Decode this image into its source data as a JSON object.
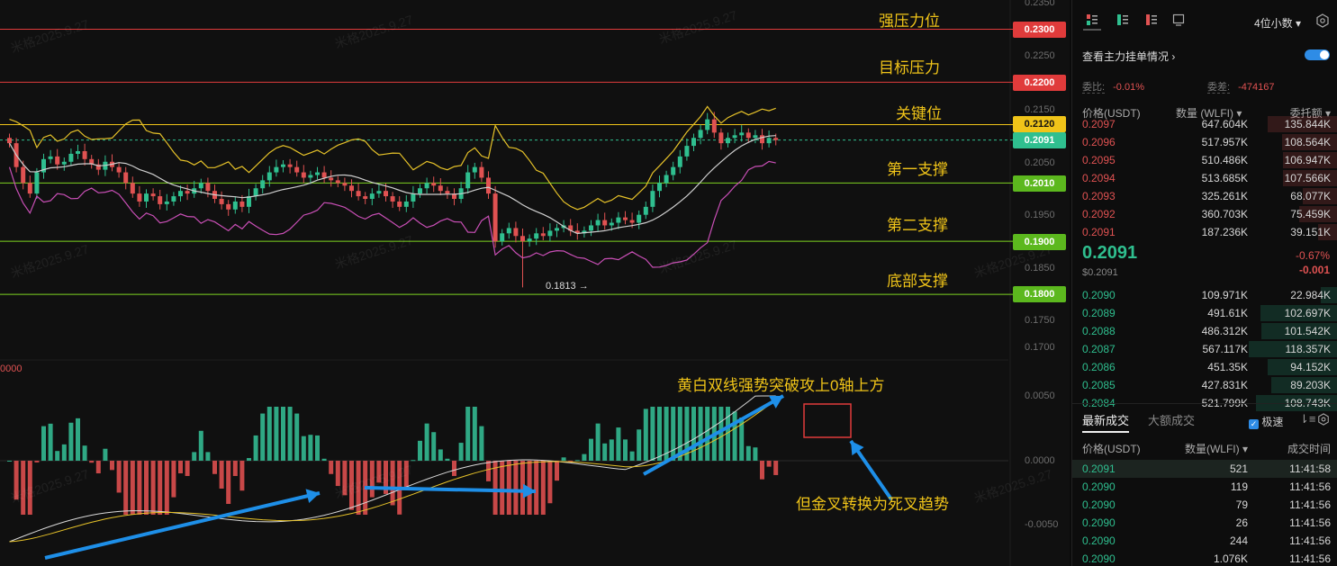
{
  "chart_data": {
    "type": "candlestick",
    "price_axis": [
      "0.2350",
      "0.2300",
      "0.2250",
      "0.2200",
      "0.2150",
      "0.2100",
      "0.2050",
      "0.2000",
      "0.1950",
      "0.1900",
      "0.1850",
      "0.1800",
      "0.1750",
      "0.1700"
    ],
    "macd_axis": [
      "0.0050",
      "0.0000",
      "-0.0050"
    ],
    "macd_left_label": "0000",
    "low_marker": "0.1813",
    "levels": [
      {
        "price": "0.2300",
        "label": "强压力位",
        "color": "#e03b3b"
      },
      {
        "price": "0.2200",
        "label": "目标压力",
        "color": "#e03b3b"
      },
      {
        "price": "0.2120",
        "label": "关键位",
        "color": "#f0c419"
      },
      {
        "price": "0.2010",
        "label": "第一支撑",
        "color": "#7ed321"
      },
      {
        "price": "0.1900",
        "label": "第二支撑",
        "color": "#7ed321"
      },
      {
        "price": "0.1800",
        "label": "底部支撑",
        "color": "#7ed321"
      }
    ],
    "current_price_tag": "0.2091",
    "annotations": {
      "macd_break": "黄白双线强势突破攻上0轴上方",
      "death_cross": "但金叉转换为死叉趋势"
    },
    "watermark": "米格2025.9.27"
  },
  "toolbar": {
    "decimals_label": "4位小数",
    "icons": [
      "orderbook-both-icon",
      "orderbook-bids-icon",
      "orderbook-asks-icon",
      "screen-icon",
      "settings-icon"
    ]
  },
  "orderbook": {
    "link_label": "查看主力挂单情况",
    "ratio_label": "委比:",
    "ratio_value": "-0.01%",
    "diff_label": "委差:",
    "diff_value": "-474167",
    "headers": {
      "price": "价格(USDT)",
      "qty": "数量 (WLFI)",
      "total": "委托额"
    },
    "asks": [
      {
        "price": "0.2097",
        "qty": "647.604K",
        "total": "135.844K"
      },
      {
        "price": "0.2096",
        "qty": "517.957K",
        "total": "108.564K"
      },
      {
        "price": "0.2095",
        "qty": "510.486K",
        "total": "106.947K"
      },
      {
        "price": "0.2094",
        "qty": "513.685K",
        "total": "107.566K"
      },
      {
        "price": "0.2093",
        "qty": "325.261K",
        "total": "68.077K"
      },
      {
        "price": "0.2092",
        "qty": "360.703K",
        "total": "75.459K"
      },
      {
        "price": "0.2091",
        "qty": "187.236K",
        "total": "39.151K"
      }
    ],
    "last_price": "0.2091",
    "last_price_usd": "$0.2091",
    "change_pct": "-0.67%",
    "change_abs": "-0.001",
    "bids": [
      {
        "price": "0.2090",
        "qty": "109.971K",
        "total": "22.984K"
      },
      {
        "price": "0.2089",
        "qty": "491.61K",
        "total": "102.697K"
      },
      {
        "price": "0.2088",
        "qty": "486.312K",
        "total": "101.542K"
      },
      {
        "price": "0.2087",
        "qty": "567.117K",
        "total": "118.357K"
      },
      {
        "price": "0.2086",
        "qty": "451.35K",
        "total": "94.152K"
      },
      {
        "price": "0.2085",
        "qty": "427.831K",
        "total": "89.203K"
      },
      {
        "price": "0.2084",
        "qty": "521.799K",
        "total": "108.743K"
      }
    ]
  },
  "trades": {
    "tab_latest": "最新成交",
    "tab_large": "大额成交",
    "fast_label": "极速",
    "headers": {
      "price": "价格(USDT)",
      "qty": "数量(WLFI)",
      "time": "成交时间"
    },
    "rows": [
      {
        "price": "0.2091",
        "qty": "521",
        "time": "11:41:58"
      },
      {
        "price": "0.2090",
        "qty": "119",
        "time": "11:41:56"
      },
      {
        "price": "0.2090",
        "qty": "79",
        "time": "11:41:56"
      },
      {
        "price": "0.2090",
        "qty": "26",
        "time": "11:41:56"
      },
      {
        "price": "0.2090",
        "qty": "244",
        "time": "11:41:56"
      },
      {
        "price": "0.2090",
        "qty": "1.076K",
        "time": "11:41:56"
      }
    ]
  },
  "colors": {
    "up": "#2fbf8f",
    "down": "#e05252",
    "accent": "#2e8ce6",
    "level_yellow": "#f0c419"
  }
}
